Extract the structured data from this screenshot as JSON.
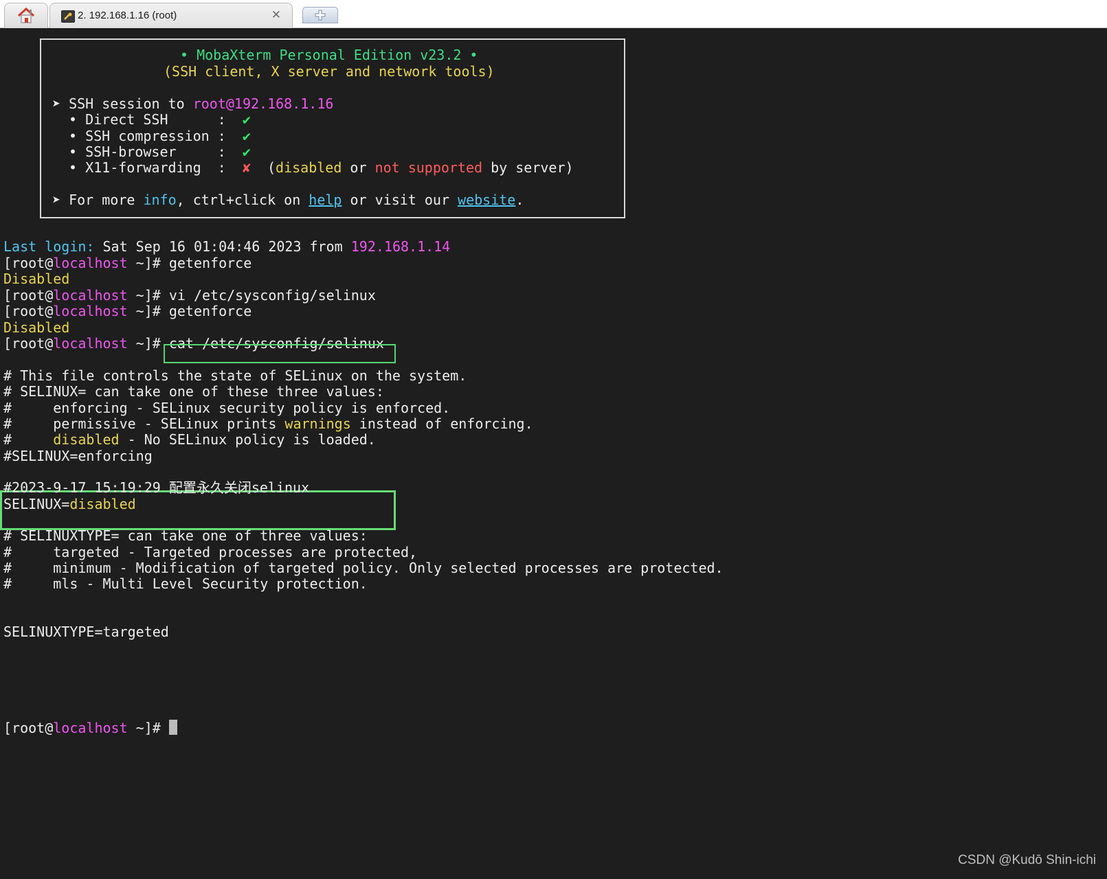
{
  "tabs": {
    "home_icon": "home-icon",
    "session_title": "2. 192.168.1.16 (root)",
    "session_icon": "wrench-icon",
    "close_glyph": "✕",
    "new_tab_glyph": "✚"
  },
  "banner": {
    "title": "• MobaXterm Personal Edition v23.2 •",
    "subtitle": "(SSH client, X server and network tools)",
    "ssh_prefix": "➤ SSH session to ",
    "ssh_target": "root@192.168.1.16",
    "direct_ssh": "• Direct SSH      :  ",
    "compression": "• SSH compression :  ",
    "browser": "• SSH-browser     :  ",
    "x11": "• X11-forwarding  :  ",
    "check": "✔",
    "cross": "✘",
    "x11_note_open": "  (",
    "x11_disabled": "disabled",
    "x11_or": " or ",
    "x11_not_supported": "not supported",
    "x11_by_server": " by server)",
    "more_prefix": "➤ For more ",
    "info": "info",
    "more_mid": ", ctrl+click on ",
    "help": "help",
    "more_mid2": " or visit our ",
    "website": "website",
    "more_end": "."
  },
  "session": {
    "last_login_label": "Last login:",
    "last_login_value": " Sat Sep 16 01:04:46 2023 from ",
    "last_login_ip": "192.168.1.14",
    "prompt_open": "[root@",
    "prompt_host": "localhost",
    "prompt_close": " ~]# ",
    "cmd1": "getenforce",
    "out_disabled": "Disabled",
    "cmd2": "vi /etc/sysconfig/selinux",
    "cmd3": "getenforce",
    "cmd4": "cat /etc/sysconfig/selinux"
  },
  "file": {
    "l1": "# This file controls the state of SELinux on the system.",
    "l2": "# SELINUX= can take one of these three values:",
    "l3": "#     enforcing - SELinux security policy is enforced.",
    "l4_pre": "#     permissive - SELinux prints ",
    "l4_warn": "warnings",
    "l4_post": " instead of enforcing.",
    "l5_pre": "#     ",
    "l5_dis": "disabled",
    "l5_post": " - No SELinux policy is loaded.",
    "l6": "#SELINUX=enforcing",
    "l7": "#2023-9-17 15:19:29 配置永久关闭selinux",
    "l8_pre": "SELINUX=",
    "l8_val": "disabled",
    "l9": "# SELINUXTYPE= can take one of three values:",
    "l10": "#     targeted - Targeted processes are protected,",
    "l11": "#     minimum - Modification of targeted policy. Only selected processes are protected.",
    "l12": "#     mls - Multi Level Security protection.",
    "l13": "SELINUXTYPE=targeted"
  },
  "watermark": "CSDN @Kudō Shin-ichi"
}
